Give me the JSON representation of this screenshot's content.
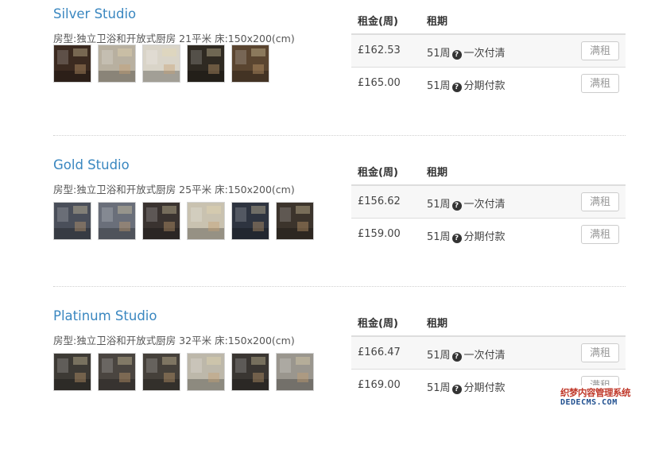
{
  "header": {
    "rent_label": "租金(周)",
    "term_label": "租期"
  },
  "rooms": [
    {
      "name": "Silver Studio",
      "description": "房型:独立卫浴和开放式厨房 21平米 床:150x200(cm)",
      "thumb_colors": [
        "#3b2a20",
        "#b8b0a0",
        "#d9d4c8",
        "#2f2a22",
        "#5a4530"
      ],
      "options": [
        {
          "price": "£162.53",
          "weeks": "51周",
          "plan": "一次付清",
          "button": "满租"
        },
        {
          "price": "£165.00",
          "weeks": "51周",
          "plan": "分期付款",
          "button": "满租"
        }
      ]
    },
    {
      "name": "Gold Studio",
      "description": "房型:独立卫浴和开放式厨房 25平米 床:150x200(cm)",
      "thumb_colors": [
        "#4a4f5a",
        "#6a6f7a",
        "#3a3330",
        "#c9c2b0",
        "#2e3440",
        "#3c342c"
      ],
      "options": [
        {
          "price": "£156.62",
          "weeks": "51周",
          "plan": "一次付清",
          "button": "满租"
        },
        {
          "price": "£159.00",
          "weeks": "51周",
          "plan": "分期付款",
          "button": "满租"
        }
      ]
    },
    {
      "name": "Platinum Studio",
      "description": "房型:独立卫浴和开放式厨房 32平米 床:150x200(cm)",
      "thumb_colors": [
        "#3d3a35",
        "#4a4540",
        "#45403a",
        "#bdb8aa",
        "#3a3632",
        "#9a968e"
      ],
      "options": [
        {
          "price": "£166.47",
          "weeks": "51周",
          "plan": "一次付清",
          "button": "满租"
        },
        {
          "price": "£169.00",
          "weeks": "51周",
          "plan": "分期付款",
          "button": "满租"
        }
      ]
    }
  ],
  "watermark": {
    "line1": "织梦内容管理系统",
    "line2": "DEDECMS.COM"
  },
  "colors": {
    "title": "#3a87c0",
    "stripe": "#f7f7f7",
    "border": "#dddddd"
  }
}
